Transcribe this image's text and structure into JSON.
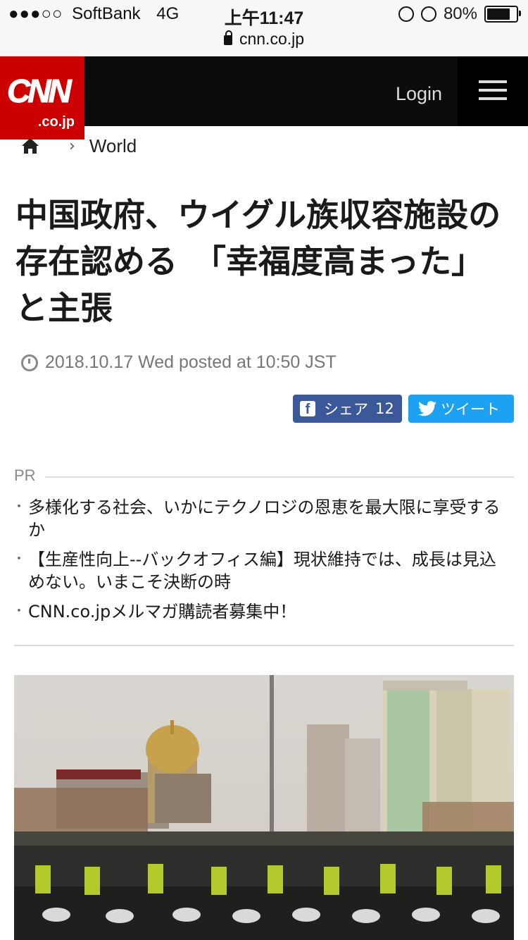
{
  "status_bar": {
    "signal": "●●●○○",
    "carrier": "SoftBank",
    "network": "4G",
    "time": "上午11:47",
    "battery": "80%",
    "battery_level": 0.8,
    "url": "cnn.co.jp"
  },
  "header": {
    "logo_text": "CNN",
    "logo_sub": ".co.jp",
    "login_label": "Login",
    "brand_color": "#cc0000"
  },
  "breadcrumb": {
    "home_icon": "home-icon",
    "section": "World"
  },
  "article": {
    "title": "中国政府、ウイグル族収容施設の存在認める　「幸福度高まった」と主張",
    "posted": "2018.10.17 Wed posted at 10:50 JST"
  },
  "share": {
    "facebook_label": "シェア",
    "facebook_count": "12",
    "twitter_label": "ツイート",
    "facebook_color": "#3b5998",
    "twitter_color": "#1da1f2"
  },
  "pr": {
    "label": "PR",
    "items": [
      "多様化する社会、いかにテクノロジの恩恵を最大限に享受するか",
      "【生産性向上--バックオフィス編】現状維持では、成長は見込めない。いまこそ決断の時",
      "CNN.co.jpメルマガ購読者募集中！"
    ]
  }
}
